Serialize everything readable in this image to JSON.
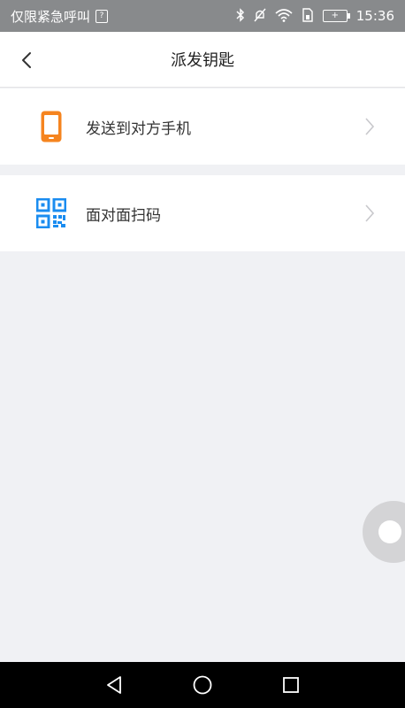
{
  "status_bar": {
    "left_text": "仅限紧急呼叫",
    "time": "15:36",
    "icons": [
      "sim-icon",
      "bluetooth-icon",
      "mute-icon",
      "wifi-icon",
      "sim-card-icon",
      "battery-charging-icon"
    ]
  },
  "header": {
    "title": "派发钥匙",
    "back_icon": "back-arrow-icon"
  },
  "options": [
    {
      "label": "发送到对方手机",
      "icon": "phone-icon",
      "icon_color": "#f5841f"
    },
    {
      "label": "面对面扫码",
      "icon": "qr-code-icon",
      "icon_color": "#1a8cf0"
    }
  ],
  "nav_bar": {
    "buttons": [
      "back-triangle-icon",
      "home-circle-icon",
      "recents-square-icon"
    ]
  },
  "colors": {
    "status_bar_bg": "#888a8c",
    "page_bg": "#f0f1f4",
    "nav_bar_bg": "#000000"
  }
}
